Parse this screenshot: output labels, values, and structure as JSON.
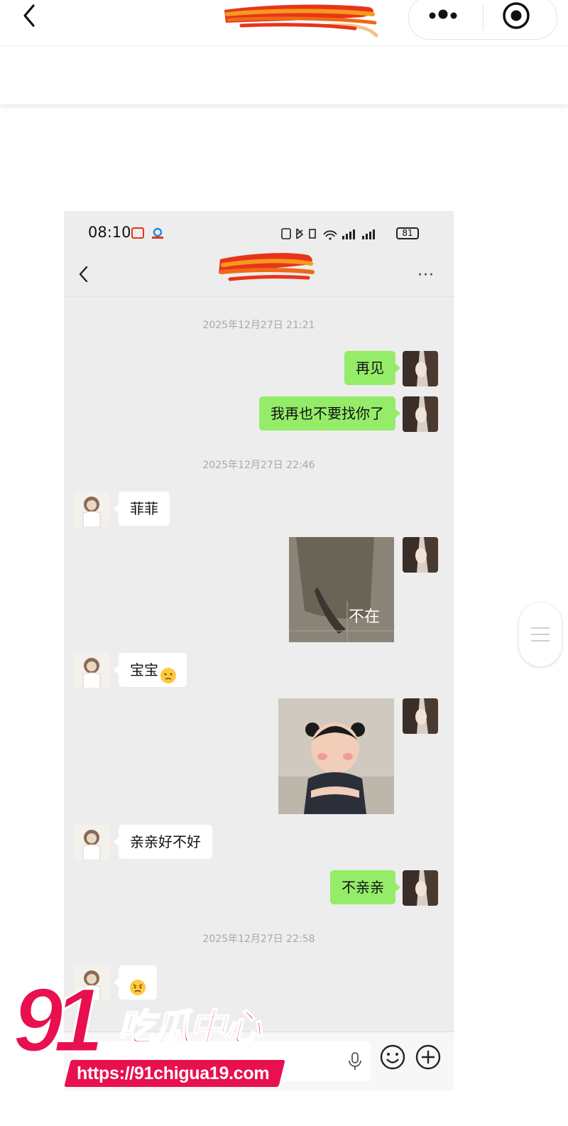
{
  "colors": {
    "accent_green": "#95ec69",
    "chat_bg": "#ededed",
    "watermark_red": "#e8104f"
  },
  "mini_program_bar": {
    "back_icon": "chevron-left-icon",
    "more_icon": "more-dots-icon",
    "close_icon": "target-icon"
  },
  "phone": {
    "status": {
      "time": "08:10",
      "battery": "81"
    },
    "nav": {
      "more": "···"
    },
    "messages": {
      "ts1": "2025年12月27日 21:21",
      "m1": "再见",
      "m2": "我再也不要找你了",
      "ts2": "2025年12月27日 22:46",
      "m3": "菲菲",
      "m4_caption": "不在",
      "m5": "宝宝",
      "m7": "亲亲好不好",
      "m8": "不亲亲",
      "ts3": "2025年12月27日 22:58"
    }
  },
  "watermark": {
    "brand": "91吃瓜中心",
    "url": "https://91chigua19.com"
  }
}
